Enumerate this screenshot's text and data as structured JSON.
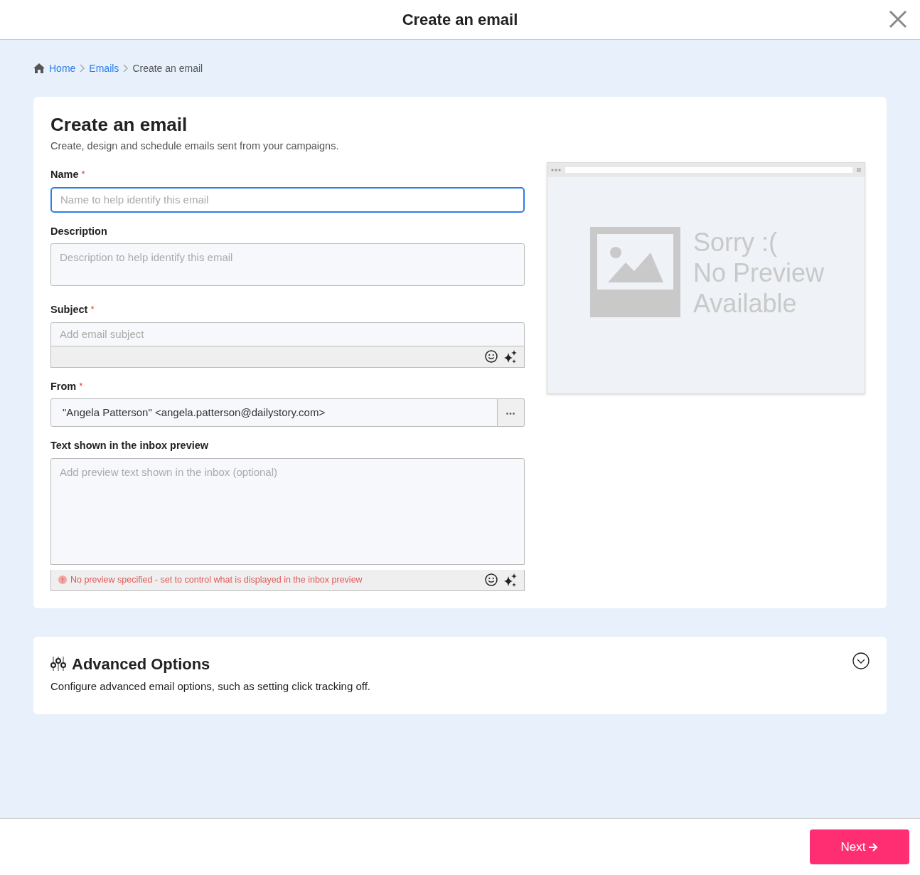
{
  "window": {
    "title": "Create an email"
  },
  "breadcrumb": [
    {
      "label": "Home",
      "link": true
    },
    {
      "label": "Emails",
      "link": true
    },
    {
      "label": "Create an email",
      "link": false
    }
  ],
  "form": {
    "title": "Create an email",
    "required_mark": "*",
    "subtitle": "Create, design and schedule emails sent from your campaigns.",
    "fields": [
      {
        "kind": "input",
        "label": "Name",
        "required": true,
        "placeholder": "Name to help identify this email",
        "focused": true
      },
      {
        "kind": "textarea",
        "label": "Description",
        "required": false,
        "placeholder": "Description to help identify this email",
        "focused": false
      },
      {
        "kind": "subject",
        "label": "Subject",
        "required": true,
        "placeholder": "Add email subject",
        "focused": false
      },
      {
        "kind": "from",
        "label": "From",
        "required": true,
        "value": "\"Angela Patterson\" <angela.patterson@dailystory.com>",
        "focused": false
      },
      {
        "kind": "preview",
        "label": "Text shown in the inbox preview",
        "required": false,
        "placeholder": "Add preview text shown in the inbox (optional)",
        "warning": "No preview specified - set to control what is displayed in the inbox preview",
        "focused": false
      }
    ]
  },
  "preview": {
    "lines": [
      "Sorry :(",
      "No Preview",
      "Available"
    ]
  },
  "advanced": {
    "title": "Advanced Options",
    "description": "Configure advanced email options, such as setting click tracking off.",
    "expanded": false
  },
  "footer": {
    "next": "Next"
  }
}
